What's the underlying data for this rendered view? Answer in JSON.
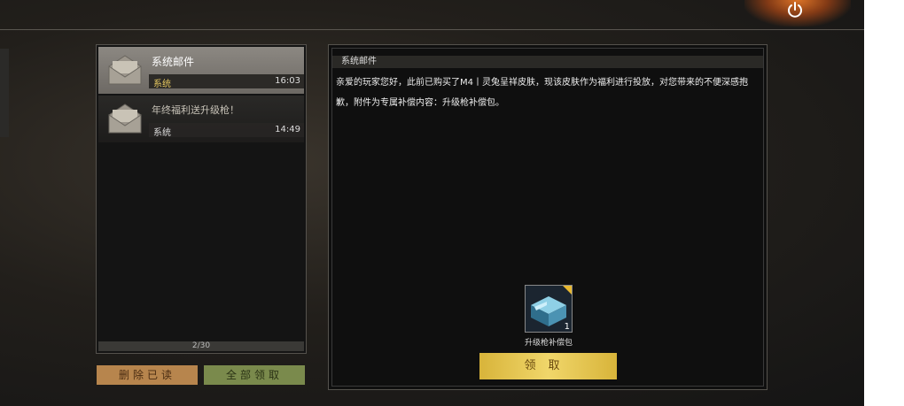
{
  "mail_list": {
    "items": [
      {
        "title": "系统邮件",
        "sender": "系统",
        "time": "16:03",
        "selected": true
      },
      {
        "title": "年终福利送升级枪！",
        "sender": "系统",
        "time": "14:49",
        "selected": false
      }
    ],
    "pager": "2/30"
  },
  "actions": {
    "delete_read_label": "删除已读",
    "claim_all_label": "全部领取"
  },
  "detail": {
    "title": "系统邮件",
    "body": "亲爱的玩家您好，此前已购买了M4丨灵兔呈祥皮肤，现该皮肤作为福利进行投放，对您带来的不便深感抱歉，附件为专属补偿内容：升级枪补偿包。",
    "reward": {
      "name": "升级枪补偿包",
      "count": "1"
    },
    "claim_label": "领取"
  },
  "colors": {
    "accent_gold": "#e6c860",
    "claim_button": "#f0d66a",
    "delete_button": "#b7854d",
    "claim_all_button": "#7a8a4c"
  },
  "icons": {
    "power": "power-icon",
    "mail": "envelope-icon",
    "reward": "crate-icon"
  }
}
